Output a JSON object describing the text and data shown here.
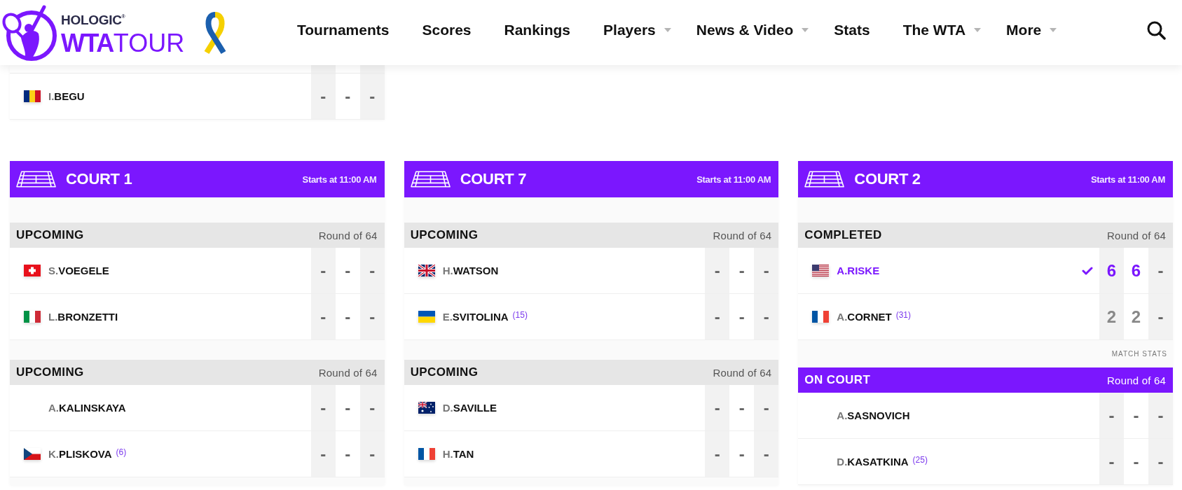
{
  "header": {
    "sponsor": "HOLOGIC$^{®}$",
    "logo_text": "**WTA**TOUR",
    "nav": [
      {
        "label": "Tournaments",
        "has_menu": false
      },
      {
        "label": "Scores",
        "has_menu": false
      },
      {
        "label": "Rankings",
        "has_menu": false
      },
      {
        "label": "Players",
        "has_menu": true
      },
      {
        "label": "News & Video",
        "has_menu": true
      },
      {
        "label": "Stats",
        "has_menu": false
      },
      {
        "label": "The WTA",
        "has_menu": true
      },
      {
        "label": "More",
        "has_menu": true
      }
    ]
  },
  "previous_court": {
    "players": [
      {
        "initial": "I.",
        "surname": "BEGU",
        "kind": "romania",
        "winner": false,
        "scores": [
          "-",
          "-",
          "-"
        ]
      }
    ]
  },
  "courts": [
    {
      "name": "COURT 1",
      "start_time": "Starts at 11:00 AM",
      "matches": [
        {
          "kind": "upcoming",
          "status": "UPCOMING",
          "round": "Round of 64",
          "players": [
            {
              "initial": "S.",
              "surname": "VOEGELE",
              "kind": "switzerland",
              "winner": false,
              "scores": [
                "-",
                "-",
                "-"
              ]
            },
            {
              "initial": "L.",
              "surname": "BRONZETTI",
              "kind": "italy",
              "winner": false,
              "scores": [
                "-",
                "-",
                "-"
              ]
            }
          ]
        },
        {
          "kind": "upcoming",
          "status": "UPCOMING",
          "round": "Round of 64",
          "players": [
            {
              "initial": "A.",
              "surname": "KALINSKAYA",
              "kind": "neutral",
              "winner": false,
              "scores": [
                "-",
                "-",
                "-"
              ]
            },
            {
              "initial": "K.",
              "surname": "PLISKOVA",
              "seed": "(6)",
              "kind": "czechia",
              "winner": false,
              "scores": [
                "-",
                "-",
                "-"
              ]
            }
          ]
        }
      ]
    },
    {
      "name": "COURT 7",
      "start_time": "Starts at 11:00 AM",
      "matches": [
        {
          "kind": "upcoming",
          "status": "UPCOMING",
          "round": "Round of 64",
          "players": [
            {
              "initial": "H.",
              "surname": "WATSON",
              "kind": "gb",
              "winner": false,
              "scores": [
                "-",
                "-",
                "-"
              ]
            },
            {
              "initial": "E.",
              "surname": "SVITOLINA",
              "seed": "(15)",
              "kind": "ukraine",
              "winner": false,
              "scores": [
                "-",
                "-",
                "-"
              ]
            }
          ]
        },
        {
          "kind": "upcoming",
          "status": "UPCOMING",
          "round": "Round of 64",
          "players": [
            {
              "initial": "D.",
              "surname": "SAVILLE",
              "kind": "australia",
              "winner": false,
              "scores": [
                "-",
                "-",
                "-"
              ]
            },
            {
              "initial": "H.",
              "surname": "TAN",
              "kind": "france",
              "winner": false,
              "scores": [
                "-",
                "-",
                "-"
              ]
            }
          ]
        }
      ]
    },
    {
      "name": "COURT 2",
      "start_time": "Starts at 11:00 AM",
      "matches": [
        {
          "kind": "completed",
          "status": "COMPLETED",
          "round": "Round of 64",
          "link": "MATCH STATS",
          "players": [
            {
              "initial": "A.",
              "surname": "RISKE",
              "kind": "usa",
              "winner": true,
              "scores": [
                "6",
                "6",
                "-"
              ]
            },
            {
              "initial": "A.",
              "surname": "CORNET",
              "seed": "(31)",
              "kind": "france",
              "winner": false,
              "scores": [
                "2",
                "2",
                "-"
              ]
            }
          ]
        },
        {
          "kind": "live",
          "status": "ON COURT",
          "round": "Round of 64",
          "players": [
            {
              "initial": "A.",
              "surname": "SASNOVICH",
              "kind": "neutral",
              "winner": false,
              "scores": [
                "-",
                "-",
                "-"
              ]
            },
            {
              "initial": "D.",
              "surname": "KASATKINA",
              "seed": "(25)",
              "kind": "neutral",
              "winner": false,
              "scores": [
                "-",
                "-",
                "-"
              ]
            }
          ]
        }
      ]
    }
  ]
}
